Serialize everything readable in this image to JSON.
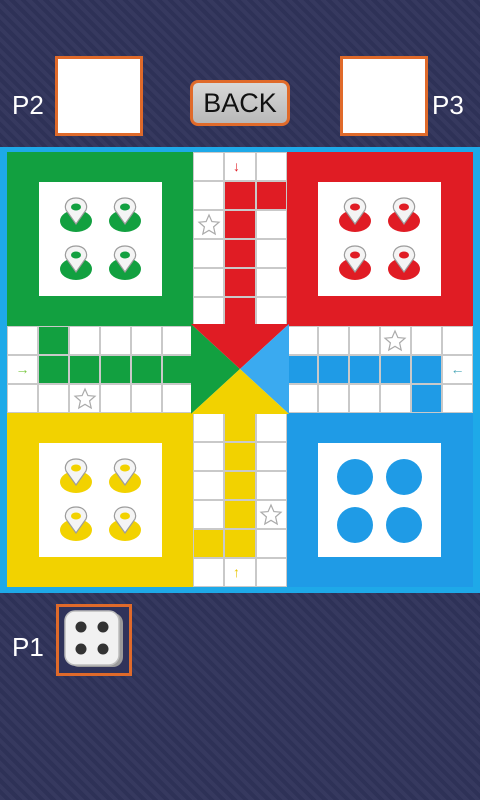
{
  "players": {
    "p1_label": "P1",
    "p2_label": "P2",
    "p3_label": "P3"
  },
  "controls": {
    "back_label": "BACK"
  },
  "board": {
    "colors": {
      "green": "#12a040",
      "red": "#e01c24",
      "yellow": "#f2d200",
      "blue": "#1f9be6"
    },
    "pawn_counts": {
      "green": 4,
      "red": 4,
      "yellow": 4,
      "blue": 0
    },
    "empty_spots_blue": 4,
    "safe_star_icon": "star-icon",
    "entry_arrow_icons": [
      "arrow-down-icon",
      "arrow-right-icon",
      "arrow-left-icon",
      "arrow-up-icon"
    ]
  },
  "dice": {
    "value": 4,
    "icon": "dice-icon"
  }
}
